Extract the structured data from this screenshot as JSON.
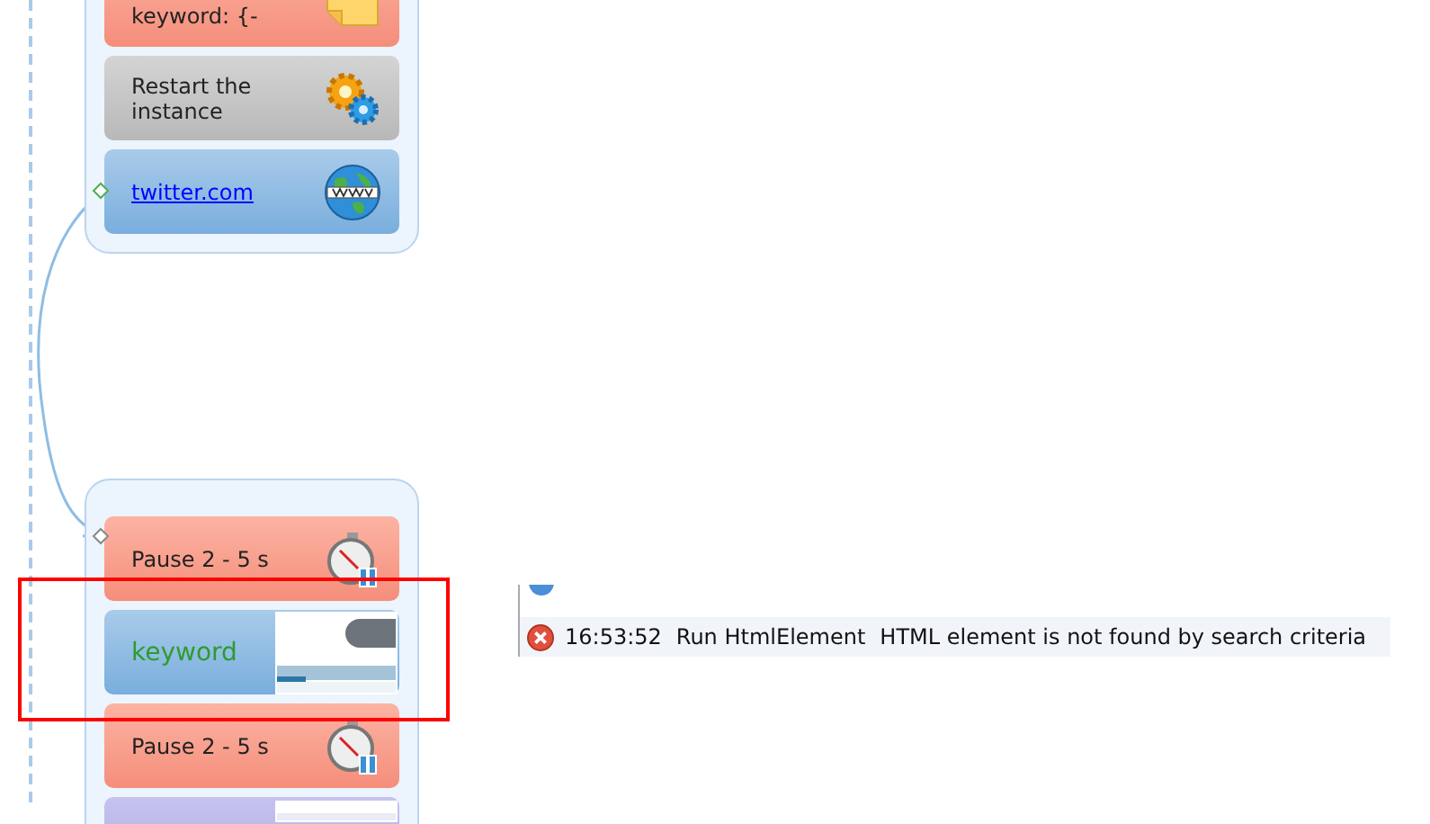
{
  "groups": [
    {
      "nodes": [
        {
          "kind": "variable",
          "label": "keyword: {-"
        },
        {
          "kind": "restart",
          "label": "Restart the instance"
        },
        {
          "kind": "navigate",
          "label": "twitter.com"
        }
      ]
    },
    {
      "nodes": [
        {
          "kind": "pause",
          "label": "Pause 2 - 5 s"
        },
        {
          "kind": "element",
          "label": "keyword"
        },
        {
          "kind": "pause",
          "label": "Pause 2 - 5 s"
        },
        {
          "kind": "purple"
        }
      ]
    }
  ],
  "log": [
    {
      "kind": "error",
      "time": "16:53:52",
      "action": "Run HtmlElement",
      "message": "HTML element is not found by search criteria"
    }
  ],
  "highlight": {
    "shown": true
  }
}
